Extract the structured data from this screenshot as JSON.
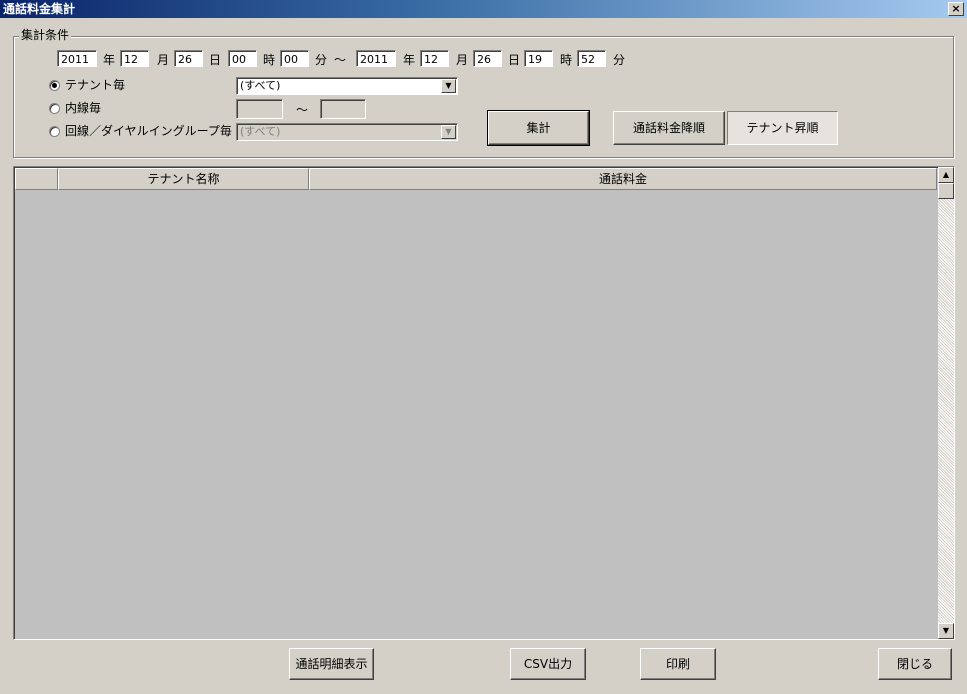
{
  "window": {
    "title": "通話料金集計",
    "close_glyph": "×"
  },
  "condition_group": {
    "legend": "集計条件"
  },
  "date_range": {
    "from": {
      "year": "2011",
      "month": "12",
      "day": "26",
      "hour": "00",
      "minute": "00"
    },
    "to": {
      "year": "2011",
      "month": "12",
      "day": "26",
      "hour": "19",
      "minute": "52"
    },
    "labels": {
      "year": "年",
      "month": "月",
      "day": "日",
      "hour": "時",
      "minute": "分"
    },
    "separator": "～"
  },
  "options": {
    "tenant": {
      "label": "テナント毎",
      "selected": true,
      "combo_value": "(すべて)"
    },
    "extension": {
      "label": "内線毎",
      "selected": false,
      "from_value": "",
      "to_value": "",
      "separator": "～"
    },
    "line_group": {
      "label": "回線／ダイヤルイングループ毎",
      "selected": false,
      "combo_value": "(すべて)"
    }
  },
  "buttons": {
    "aggregate": "集計",
    "sort_fee_desc": "通話料金降順",
    "sort_tenant_asc": "テナント昇順",
    "show_details": "通話明細表示",
    "csv_output": "CSV出力",
    "print": "印刷",
    "close": "閉じる"
  },
  "grid": {
    "columns": [
      "",
      "テナント名称",
      "通話料金"
    ],
    "rows": []
  },
  "icons": {
    "dropdown": "down-triangle",
    "scroll_up": "up-triangle",
    "scroll_down": "down-triangle"
  }
}
